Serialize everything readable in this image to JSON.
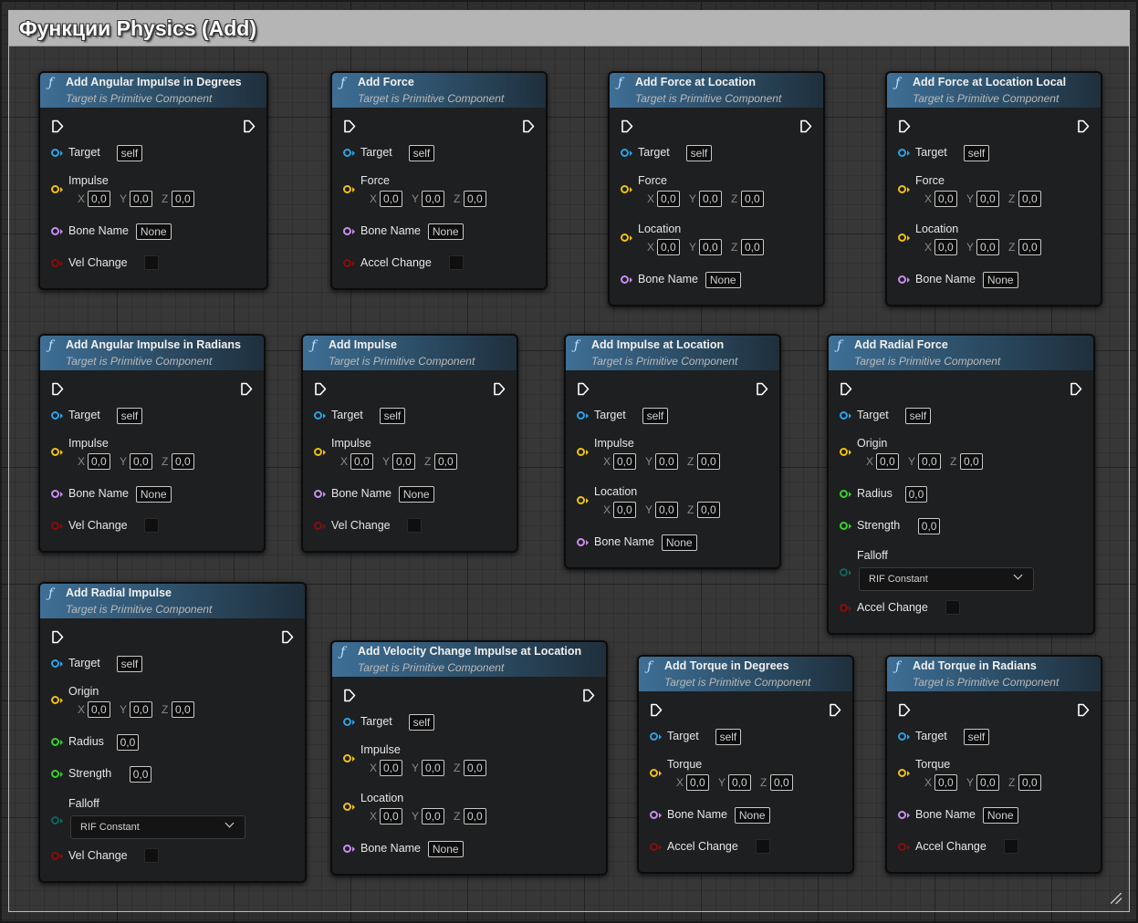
{
  "graph": {
    "comment_title": "Функции Physics (Add)"
  },
  "colors": {
    "object_pin": "#2aa2e6",
    "vector_pin": "#f2c010",
    "name_pin": "#c98ef0",
    "bool_pin": "#8a0c0c",
    "float_pin": "#37d12a",
    "enum_pin": "#0e6b62"
  },
  "nodes": [
    {
      "title": "Add Angular Impulse in Degrees",
      "subtitle": "Target is Primitive Component",
      "pins": [
        {
          "label": "Target",
          "kind": "object",
          "value": "self"
        },
        {
          "label": "Impulse",
          "kind": "vector",
          "x": "0,0",
          "y": "0,0",
          "z": "0,0"
        },
        {
          "label": "Bone Name",
          "kind": "name",
          "value": "None"
        },
        {
          "label": "Vel Change",
          "kind": "bool"
        }
      ]
    },
    {
      "title": "Add Force",
      "subtitle": "Target is Primitive Component",
      "pins": [
        {
          "label": "Target",
          "kind": "object",
          "value": "self"
        },
        {
          "label": "Force",
          "kind": "vector",
          "x": "0,0",
          "y": "0,0",
          "z": "0,0"
        },
        {
          "label": "Bone Name",
          "kind": "name",
          "value": "None"
        },
        {
          "label": "Accel Change",
          "kind": "bool"
        }
      ]
    },
    {
      "title": "Add Force at Location",
      "subtitle": "Target is Primitive Component",
      "pins": [
        {
          "label": "Target",
          "kind": "object",
          "value": "self"
        },
        {
          "label": "Force",
          "kind": "vector",
          "x": "0,0",
          "y": "0,0",
          "z": "0,0"
        },
        {
          "label": "Location",
          "kind": "vector",
          "x": "0,0",
          "y": "0,0",
          "z": "0,0"
        },
        {
          "label": "Bone Name",
          "kind": "name",
          "value": "None"
        }
      ]
    },
    {
      "title": "Add Force at Location Local",
      "subtitle": "Target is Primitive Component",
      "pins": [
        {
          "label": "Target",
          "kind": "object",
          "value": "self"
        },
        {
          "label": "Force",
          "kind": "vector",
          "x": "0,0",
          "y": "0,0",
          "z": "0,0"
        },
        {
          "label": "Location",
          "kind": "vector",
          "x": "0,0",
          "y": "0,0",
          "z": "0,0"
        },
        {
          "label": "Bone Name",
          "kind": "name",
          "value": "None"
        }
      ]
    },
    {
      "title": "Add Angular Impulse in Radians",
      "subtitle": "Target is Primitive Component",
      "pins": [
        {
          "label": "Target",
          "kind": "object",
          "value": "self"
        },
        {
          "label": "Impulse",
          "kind": "vector",
          "x": "0,0",
          "y": "0,0",
          "z": "0,0"
        },
        {
          "label": "Bone Name",
          "kind": "name",
          "value": "None"
        },
        {
          "label": "Vel Change",
          "kind": "bool"
        }
      ]
    },
    {
      "title": "Add Impulse",
      "subtitle": "Target is Primitive Component",
      "pins": [
        {
          "label": "Target",
          "kind": "object",
          "value": "self"
        },
        {
          "label": "Impulse",
          "kind": "vector",
          "x": "0,0",
          "y": "0,0",
          "z": "0,0"
        },
        {
          "label": "Bone Name",
          "kind": "name",
          "value": "None"
        },
        {
          "label": "Vel Change",
          "kind": "bool"
        }
      ]
    },
    {
      "title": "Add Impulse at Location",
      "subtitle": "Target is Primitive Component",
      "pins": [
        {
          "label": "Target",
          "kind": "object",
          "value": "self"
        },
        {
          "label": "Impulse",
          "kind": "vector",
          "x": "0,0",
          "y": "0,0",
          "z": "0,0"
        },
        {
          "label": "Location",
          "kind": "vector",
          "x": "0,0",
          "y": "0,0",
          "z": "0,0"
        },
        {
          "label": "Bone Name",
          "kind": "name",
          "value": "None"
        }
      ]
    },
    {
      "title": "Add Radial Force",
      "subtitle": "Target is Primitive Component",
      "pins": [
        {
          "label": "Target",
          "kind": "object",
          "value": "self"
        },
        {
          "label": "Origin",
          "kind": "vector",
          "x": "0,0",
          "y": "0,0",
          "z": "0,0"
        },
        {
          "label": "Radius",
          "kind": "float",
          "value": "0,0"
        },
        {
          "label": "Strength",
          "kind": "float",
          "value": "0,0"
        },
        {
          "label": "Falloff",
          "kind": "enum",
          "value": "RIF Constant"
        },
        {
          "label": "Accel Change",
          "kind": "bool"
        }
      ]
    },
    {
      "title": "Add Radial Impulse",
      "subtitle": "Target is Primitive Component",
      "pins": [
        {
          "label": "Target",
          "kind": "object",
          "value": "self"
        },
        {
          "label": "Origin",
          "kind": "vector",
          "x": "0,0",
          "y": "0,0",
          "z": "0,0"
        },
        {
          "label": "Radius",
          "kind": "float",
          "value": "0,0"
        },
        {
          "label": "Strength",
          "kind": "float",
          "value": "0,0"
        },
        {
          "label": "Falloff",
          "kind": "enum",
          "value": "RIF Constant"
        },
        {
          "label": "Vel Change",
          "kind": "bool"
        }
      ]
    },
    {
      "title": "Add Velocity Change Impulse at Location",
      "subtitle": "Target is Primitive Component",
      "pins": [
        {
          "label": "Target",
          "kind": "object",
          "value": "self"
        },
        {
          "label": "Impulse",
          "kind": "vector",
          "x": "0,0",
          "y": "0,0",
          "z": "0,0"
        },
        {
          "label": "Location",
          "kind": "vector",
          "x": "0,0",
          "y": "0,0",
          "z": "0,0"
        },
        {
          "label": "Bone Name",
          "kind": "name",
          "value": "None"
        }
      ]
    },
    {
      "title": "Add Torque in Degrees",
      "subtitle": "Target is Primitive Component",
      "pins": [
        {
          "label": "Target",
          "kind": "object",
          "value": "self"
        },
        {
          "label": "Torque",
          "kind": "vector",
          "x": "0,0",
          "y": "0,0",
          "z": "0,0"
        },
        {
          "label": "Bone Name",
          "kind": "name",
          "value": "None"
        },
        {
          "label": "Accel Change",
          "kind": "bool"
        }
      ]
    },
    {
      "title": "Add Torque in Radians",
      "subtitle": "Target is Primitive Component",
      "pins": [
        {
          "label": "Target",
          "kind": "object",
          "value": "self"
        },
        {
          "label": "Torque",
          "kind": "vector",
          "x": "0,0",
          "y": "0,0",
          "z": "0,0"
        },
        {
          "label": "Bone Name",
          "kind": "name",
          "value": "None"
        },
        {
          "label": "Accel Change",
          "kind": "bool"
        }
      ]
    }
  ]
}
